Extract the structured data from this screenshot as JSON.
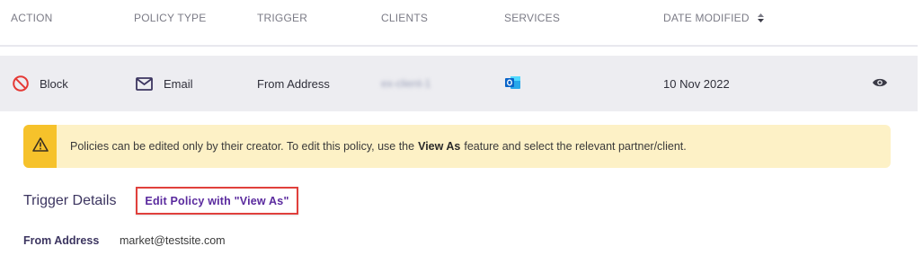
{
  "table": {
    "columns": [
      "ACTION",
      "POLICY TYPE",
      "TRIGGER",
      "CLIENTS",
      "SERVICES",
      "DATE MODIFIED"
    ],
    "row": {
      "action": "Block",
      "policy_type": "Email",
      "trigger": "From Address",
      "clients": "ex-client-1",
      "services_icon": "outlook-icon",
      "date_modified": "10 Nov 2022",
      "view_icon": "eye-icon"
    }
  },
  "warning": {
    "text_before": "Policies can be edited only by their creator. To edit this policy, use the",
    "highlight": "View As",
    "text_after": "feature and select the relevant partner/client."
  },
  "trigger_details": {
    "title": "Trigger Details",
    "edit_button": "Edit Policy with \"View As\"",
    "field_label": "From Address",
    "field_value": "market@testsite.com"
  },
  "colors": {
    "accent": "#5a2a9e",
    "block_red": "#e53935",
    "warning_bg": "#fdf1c6",
    "warning_side": "#f6c22b",
    "outlook_blue": "#0a64c8"
  }
}
